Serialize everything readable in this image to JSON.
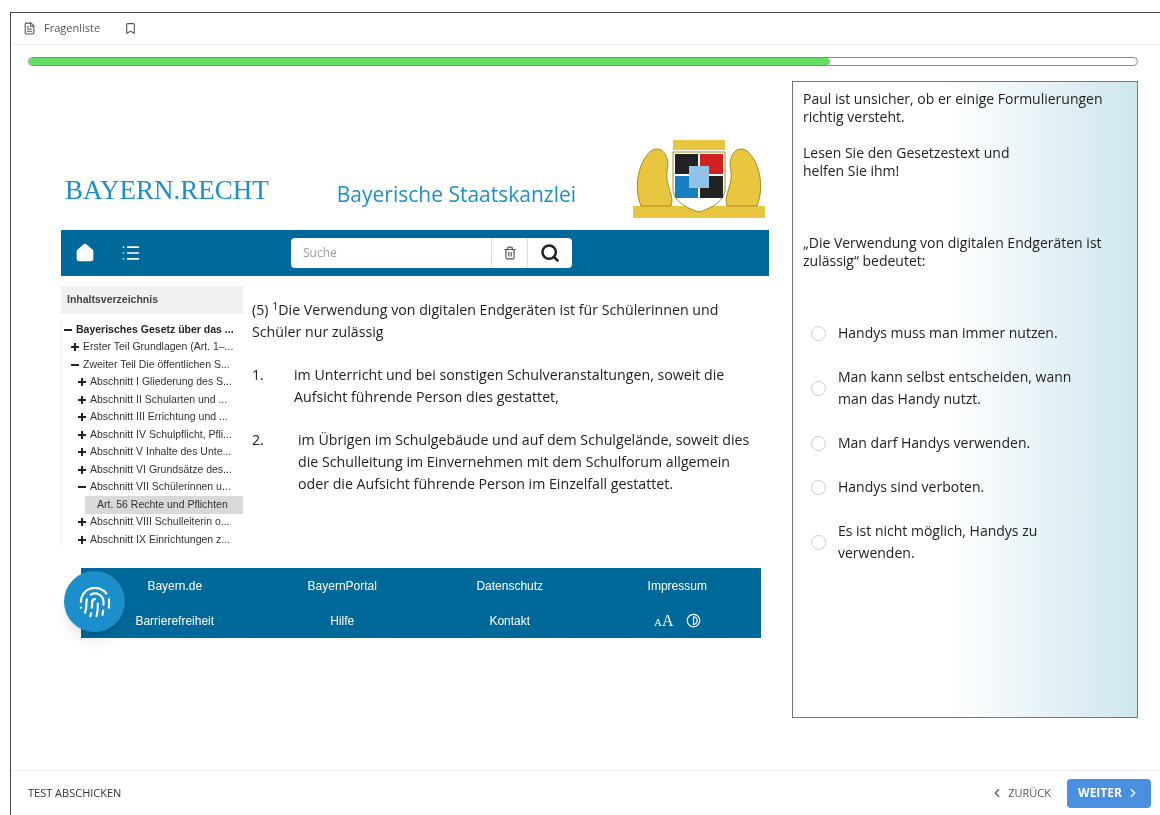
{
  "header": {
    "question_list": "Fragenliste",
    "bookmarked": false
  },
  "progress": {
    "level": 0.723
  },
  "law_page": {
    "brand": "BAYERN.RECHT",
    "agency": "Bayerische Staatskanzlei",
    "search": {
      "placeholder": "Suche"
    },
    "toc": {
      "title": "Inhaltsverzeichnis",
      "items": [
        {
          "label": "Bayerisches Gesetz über das ...",
          "expanded": true,
          "selected": false,
          "children": [
            {
              "label": "Erster Teil Grundlagen (Art. 1–...",
              "expanded": false,
              "selected": false
            },
            {
              "label": "Zweiter Teil Die öffentlichen S...",
              "expanded": true,
              "selected": false,
              "children": [
                {
                  "label": "Abschnitt I Gliederung des S...",
                  "expanded": false,
                  "selected": false
                },
                {
                  "label": "Abschnitt II Schularten und ...",
                  "expanded": false,
                  "selected": false
                },
                {
                  "label": "Abschnitt III Errichtung und ...",
                  "expanded": false,
                  "selected": false
                },
                {
                  "label": "Abschnitt IV Schulpflicht, Pfli...",
                  "expanded": false,
                  "selected": false
                },
                {
                  "label": "Abschnitt V Inhalte des Unte...",
                  "expanded": false,
                  "selected": false
                },
                {
                  "label": "Abschnitt VI Grundsätze des...",
                  "expanded": false,
                  "selected": false
                },
                {
                  "label": "Abschnitt VII Schülerinnen u...",
                  "expanded": true,
                  "selected": false,
                  "children": [
                    {
                      "label": "Art. 56 Rechte und Pflichten",
                      "selected": true
                    }
                  ]
                },
                {
                  "label": "Abschnitt VIII Schulleiterin o...",
                  "expanded": false,
                  "selected": false
                },
                {
                  "label": "Abschnitt IX Einrichtungen z...",
                  "expanded": false,
                  "selected": false
                }
              ]
            }
          ]
        }
      ]
    },
    "paragraph": "(5) $^{1}$Die Verwendung von digitalen Endgeräten ist für Schülerinnen und Schüler nur zulässig",
    "list": [
      {
        "number": "1.",
        "text": "im Unterricht und bei sonstigen Schulveranstaltungen, soweit die Aufsicht führende Person dies gestattet,"
      },
      {
        "number": "2.",
        "text": "im Übrigen im Schulgebäude und auf dem Schulgelände, soweit dies die Schulleitung im Einvernehmen mit dem Schulforum allgemein oder die Aufsicht führende Person im Einzelfall gestattet."
      }
    ],
    "footer_links": [
      [
        "Bayern.de",
        "BayernPortal",
        "Datenschutz",
        "Impressum"
      ],
      [
        "Barrierefreiheit",
        "Hilfe",
        "Kontakt"
      ]
    ],
    "text_size": {
      "small": "A",
      "large": "A"
    }
  },
  "task": {
    "intro": "Paul ist unsicher, ob er einige Formulierungen richtig versteht.",
    "instruction": [
      "Lesen Sie den Gesetzestext und",
      "helfen Sie ihm!"
    ],
    "question": "„Die Verwendung von digitalen Endgeräten ist zulässig“ bedeutet:",
    "options": [
      {
        "label": "Handys muss man immer nutzen.",
        "selected": false
      },
      {
        "label": "Man kann selbst entscheiden, wann man das Handy nutzt.",
        "selected": false
      },
      {
        "label": "Man darf Handys verwenden.",
        "selected": false
      },
      {
        "label": "Handys sind verboten.",
        "selected": false
      },
      {
        "label": "Es ist nicht möglich, Handys zu verwenden.",
        "selected": false
      }
    ]
  },
  "footer": {
    "submit": "TEST ABSCHICKEN",
    "back": "ZURÜCK",
    "next": "WEITER"
  }
}
